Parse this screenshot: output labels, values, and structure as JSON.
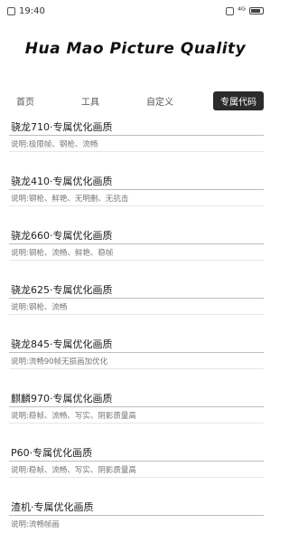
{
  "status": {
    "time": "19:40",
    "indicators": "⁴ᴳ"
  },
  "app": {
    "title": "Hua Mao Picture Quality"
  },
  "tabs": [
    {
      "label": "首页"
    },
    {
      "label": "工具"
    },
    {
      "label": "自定义"
    },
    {
      "label": "专属代码"
    }
  ],
  "items": [
    {
      "title": "骁龙710·专属优化画质",
      "desc": "说明:极限帧、钢枪、流畅"
    },
    {
      "title": "骁龙410·专属优化画质",
      "desc": "说明:钢枪、鲜艳、无明删、无抗击"
    },
    {
      "title": "骁龙660·专属优化画质",
      "desc": "说明:钢枪、流畅、鲜艳、稳帧"
    },
    {
      "title": "骁龙625·专属优化画质",
      "desc": "说明:钢枪、流畅"
    },
    {
      "title": "骁龙845·专属优化画质",
      "desc": "说明:流畅90帧无损画加优化"
    },
    {
      "title": "麒麟970·专属优化画质",
      "desc": "说明:稳帧、流畅、写实、阴影质量高"
    },
    {
      "title": "P60·专属优化画质",
      "desc": "说明:稳帧、流畅、写实、阴影质量高"
    },
    {
      "title": "渣机·专属优化画质",
      "desc": "说明:流畅帧画"
    }
  ]
}
